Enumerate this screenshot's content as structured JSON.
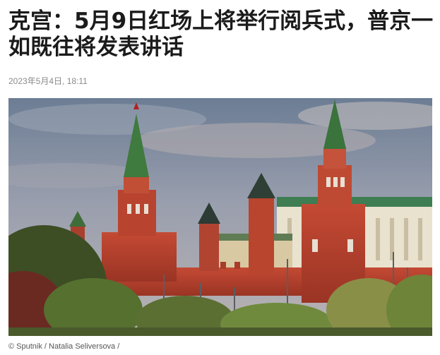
{
  "article": {
    "headline": "克宫：5月9日红场上将举行阅兵式，普京一如既往将发表讲话",
    "date": "2023年5月4日, 18:11"
  },
  "image": {
    "credit": "© Sputnik / Natalia Seliversova /"
  },
  "colors": {
    "headline_text": "#1b1b1b",
    "date_text": "#8a8a8a",
    "sky": "#7f8fa4",
    "kremlin_red": "#b8432f",
    "spire_green": "#3f7a3f",
    "foliage": "#4f6a2d"
  }
}
